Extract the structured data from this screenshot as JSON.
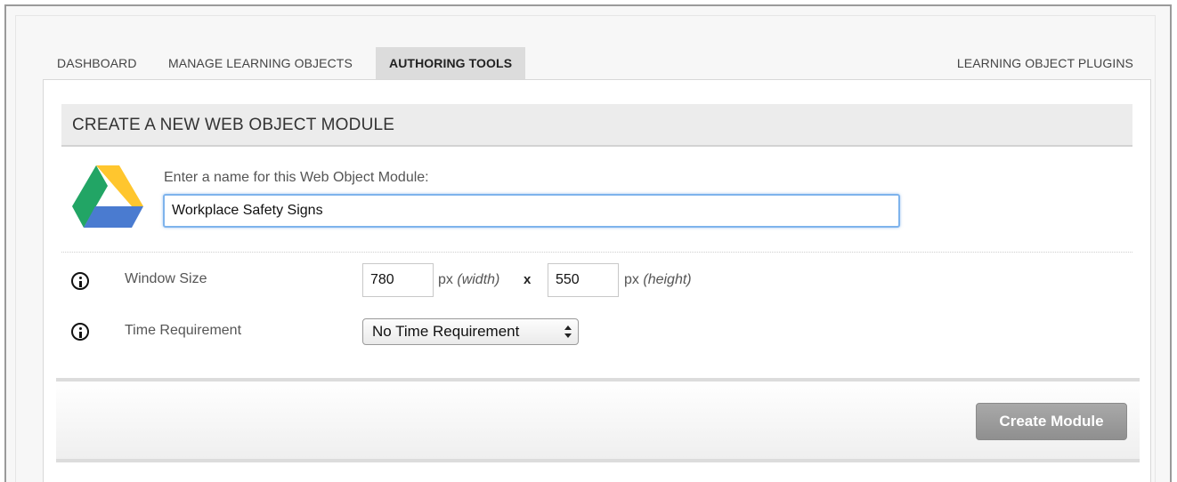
{
  "tabs": {
    "dashboard": "DASHBOARD",
    "manage": "MANAGE LEARNING OBJECTS",
    "authoring": "AUTHORING TOOLS",
    "plugins": "LEARNING OBJECT PLUGINS",
    "active": "AUTHORING TOOLS"
  },
  "panel": {
    "title": "CREATE A NEW WEB OBJECT MODULE",
    "icon": "google-drive-icon"
  },
  "form": {
    "name_label": "Enter a name for this Web Object Module:",
    "name_value": "Workplace Safety Signs",
    "window_size_label": "Window Size",
    "width_value": "780",
    "width_unit": "px",
    "width_hint": "(width)",
    "times": "x",
    "height_value": "550",
    "height_unit": "px",
    "height_hint": "(height)",
    "time_label": "Time Requirement",
    "time_selected": "No Time Requirement"
  },
  "footer": {
    "create_label": "Create Module"
  },
  "colors": {
    "drive_yellow": "#FFC62E",
    "drive_green": "#22A565",
    "drive_blue": "#4A7BD0",
    "focus_border": "#7EB3EC",
    "button_gray": "#9C9C9C"
  }
}
